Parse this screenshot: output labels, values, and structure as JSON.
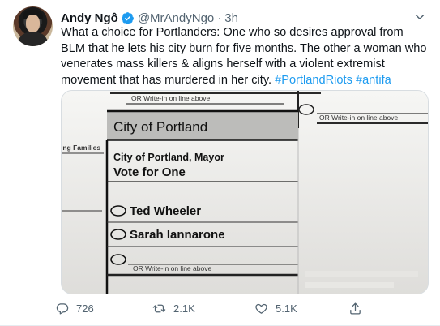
{
  "author": {
    "name": "Andy Ngô",
    "handle": "@MrAndyNgo",
    "separator": "·",
    "time": "3h"
  },
  "tweet": {
    "text_main": "What a choice for Portlanders: One who so desires approval from BLM that he lets his city burn for five months. The other a woman who venerates mass killers & aligns herself with a violent extremist movement that has murdered in her city. ",
    "hashtag1": "#PortlandRiots",
    "hashtag_space": " ",
    "hashtag2": "#antifa"
  },
  "media": {
    "ballot": {
      "write_in_top": "OR Write-in on line above",
      "write_in_right": "OR Write-in on line above",
      "section_header": "City of Portland",
      "left_fragment": "ing Families",
      "race_title": "City of Portland, Mayor",
      "vote_instruction": "Vote for One",
      "candidates": [
        "Ted Wheeler",
        "Sarah Iannarone"
      ],
      "write_in_bottom": "OR Write-in on line above"
    }
  },
  "actions": {
    "replies": "726",
    "retweets": "2.1K",
    "likes": "5.1K"
  },
  "colors": {
    "accent": "#1d9bf0",
    "muted": "#536471",
    "text": "#0f1419"
  }
}
